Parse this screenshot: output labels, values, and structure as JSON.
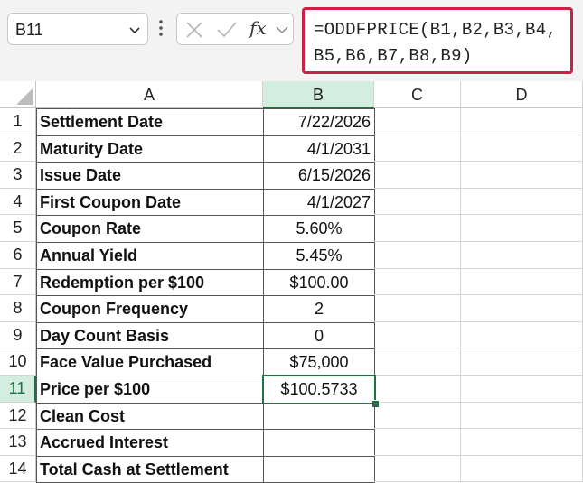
{
  "name_box": {
    "value": "B11"
  },
  "formula_bar": {
    "formula": "=ODDFPRICE(B1,B2,B3,B4,\nB5,B6,B7,B8,B9)",
    "fx_label": "fx"
  },
  "columns": [
    "A",
    "B",
    "C",
    "D"
  ],
  "selected_column": "B",
  "selected_row": 11,
  "rows": [
    {
      "num": "1",
      "label": "Settlement Date",
      "value": "7/22/2026",
      "align": "right"
    },
    {
      "num": "2",
      "label": "Maturity Date",
      "value": "4/1/2031",
      "align": "right"
    },
    {
      "num": "3",
      "label": "Issue Date",
      "value": "6/15/2026",
      "align": "right"
    },
    {
      "num": "4",
      "label": "First Coupon Date",
      "value": "4/1/2027",
      "align": "right"
    },
    {
      "num": "5",
      "label": "Coupon Rate",
      "value": "5.60%",
      "align": "center"
    },
    {
      "num": "6",
      "label": "Annual Yield",
      "value": "5.45%",
      "align": "center"
    },
    {
      "num": "7",
      "label": "Redemption per $100",
      "value": "$100.00",
      "align": "center"
    },
    {
      "num": "8",
      "label": "Coupon Frequency",
      "value": "2",
      "align": "center"
    },
    {
      "num": "9",
      "label": "Day Count Basis",
      "value": "0",
      "align": "center"
    },
    {
      "num": "10",
      "label": "Face Value Purchased",
      "value": "$75,000",
      "align": "center"
    },
    {
      "num": "11",
      "label": "Price per $100",
      "value": "$100.5733",
      "align": "center"
    },
    {
      "num": "12",
      "label": "Clean Cost",
      "value": "",
      "align": "center"
    },
    {
      "num": "13",
      "label": "Accrued Interest",
      "value": "",
      "align": "center"
    },
    {
      "num": "14",
      "label": "Total Cash at Settlement",
      "value": "",
      "align": "center"
    }
  ],
  "colors": {
    "accent": "#1e7145",
    "highlight": "#cc1f45",
    "selected_header_bg": "#d3ede0"
  }
}
